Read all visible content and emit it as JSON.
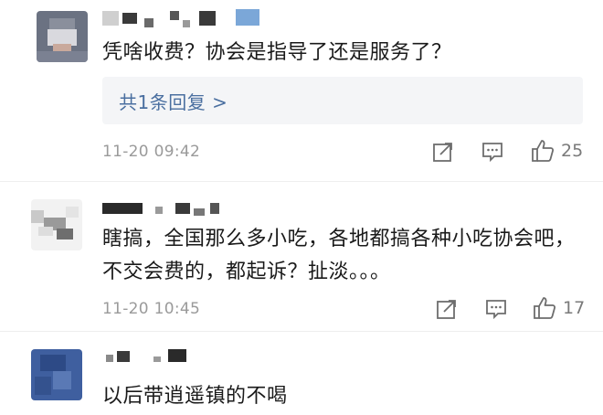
{
  "comments": [
    {
      "text": "凭啥收费？协会是指导了还是服务了？",
      "reply_label": "共1条回复 >",
      "time": "11-20 09:42",
      "likes": "25"
    },
    {
      "text": "瞎搞，全国那么多小吃，各地都搞各种小吃协会吧，不交会费的，都起诉？扯淡。。。",
      "time": "11-20 10:45",
      "likes": "17"
    },
    {
      "text": "以后带逍遥镇的不喝"
    }
  ],
  "icons": {
    "share": "share-icon",
    "comment": "comment-icon",
    "like": "thumbs-up-icon"
  },
  "colors": {
    "link": "#4a6fa0",
    "timestamp": "#9a9a9a",
    "reply_bg": "#f4f5f7"
  }
}
